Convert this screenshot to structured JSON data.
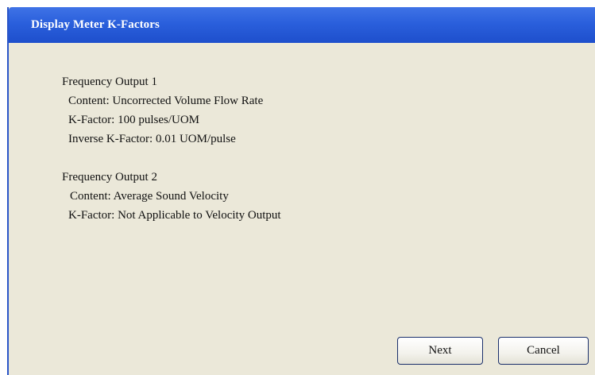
{
  "window": {
    "title": "Display Meter K-Factors"
  },
  "outputs": [
    {
      "heading": "Frequency Output 1",
      "lines": [
        "Content: Uncorrected Volume Flow Rate",
        "K-Factor: 100 pulses/UOM",
        "Inverse K-Factor: 0.01 UOM/pulse"
      ]
    },
    {
      "heading": "Frequency Output 2",
      "lines": [
        "Content: Average Sound Velocity",
        "K-Factor: Not Applicable to Velocity Output"
      ]
    }
  ],
  "buttons": {
    "next_label": "Next",
    "cancel_label": "Cancel"
  },
  "colors": {
    "titlebar": "#2a5fdc",
    "background": "#ebe8d9",
    "title_text": "#ffffff"
  }
}
